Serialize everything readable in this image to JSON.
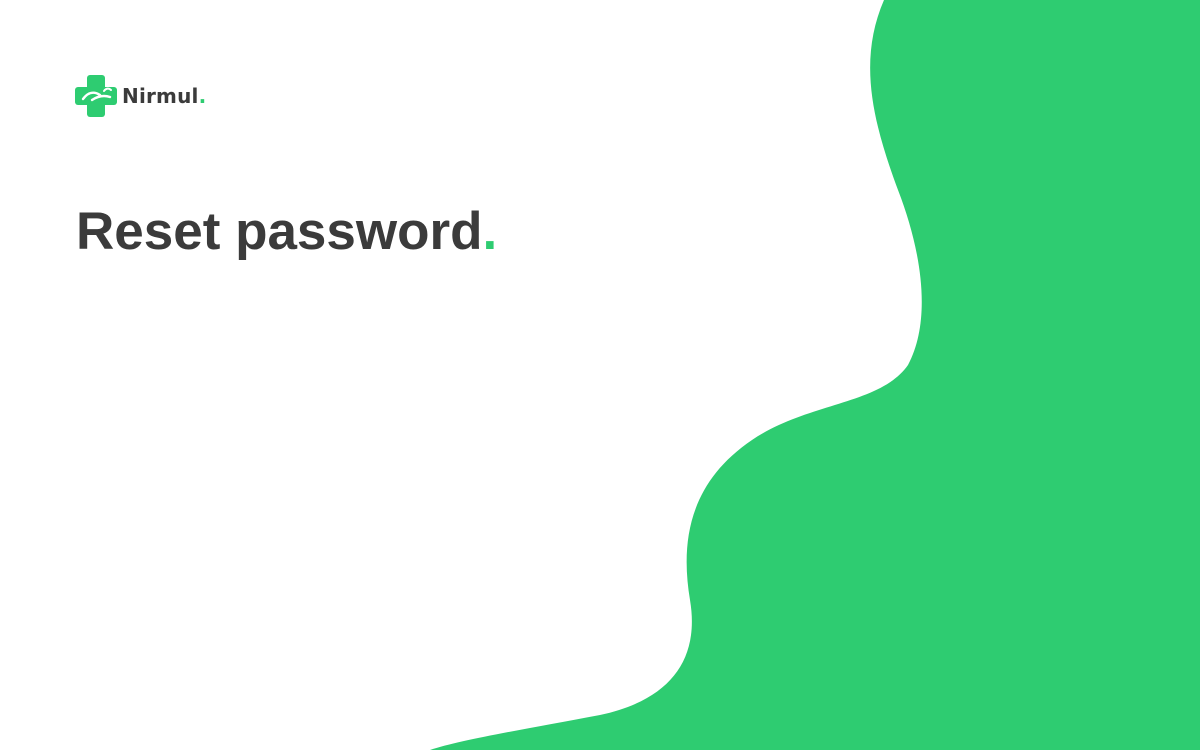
{
  "brand": {
    "name": "Nirmul",
    "name_dot": ".",
    "logo_icon": "medical-cross-hands-icon"
  },
  "page": {
    "title": "Reset password",
    "title_dot": "."
  },
  "colors": {
    "accent": "#2ecc71",
    "text": "#3b3b3b",
    "background": "#ffffff"
  }
}
